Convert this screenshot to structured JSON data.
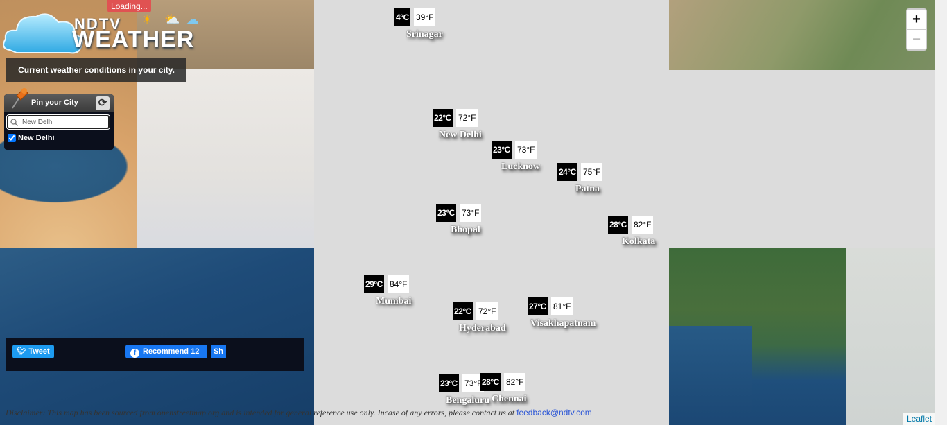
{
  "app": {
    "logo_ndtv": "NDTV",
    "logo_weather": "WEATHER",
    "loading": "Loading...",
    "subtitle": "Current weather conditions in your city."
  },
  "pin_panel": {
    "title": "Pin your City",
    "search_value": "New Delhi",
    "checked_city": "New Delhi"
  },
  "zoom": {
    "in": "+",
    "out": "−"
  },
  "cities": [
    {
      "name": "Srinagar",
      "c": "4°C",
      "f": "39°F"
    },
    {
      "name": "New Delhi",
      "c": "22°C",
      "f": "72°F"
    },
    {
      "name": "Lucknow",
      "c": "23°C",
      "f": "73°F"
    },
    {
      "name": "Patna",
      "c": "24°C",
      "f": "75°F"
    },
    {
      "name": "Bhopal",
      "c": "23°C",
      "f": "73°F"
    },
    {
      "name": "Kolkata",
      "c": "28°C",
      "f": "82°F"
    },
    {
      "name": "Mumbai",
      "c": "29°C",
      "f": "84°F"
    },
    {
      "name": "Hyderabad",
      "c": "22°C",
      "f": "72°F"
    },
    {
      "name": "Visakhapatnam",
      "c": "27°C",
      "f": "81°F"
    },
    {
      "name": "Bengaluru",
      "c": "23°C",
      "f": "73°F"
    },
    {
      "name": "Chennai",
      "c": "28°C",
      "f": "82°F"
    }
  ],
  "social": {
    "tweet": "Tweet",
    "recommend": "Recommend 12",
    "share": "Sh"
  },
  "footer": {
    "disclaimer": "Disclaimer: This map has been sourced from openstreetmap.org and is intended for general reference use only. Incase of any errors, please contact us at",
    "email": "feedback@ndtv.com",
    "attribution": "Leaflet"
  },
  "colors": {
    "temp_c_bg": "#000000",
    "temp_f_bg": "#ffffff",
    "tweet_blue": "#1d9bf0",
    "facebook_blue": "#1877f2",
    "loading_red": "#e05252"
  }
}
